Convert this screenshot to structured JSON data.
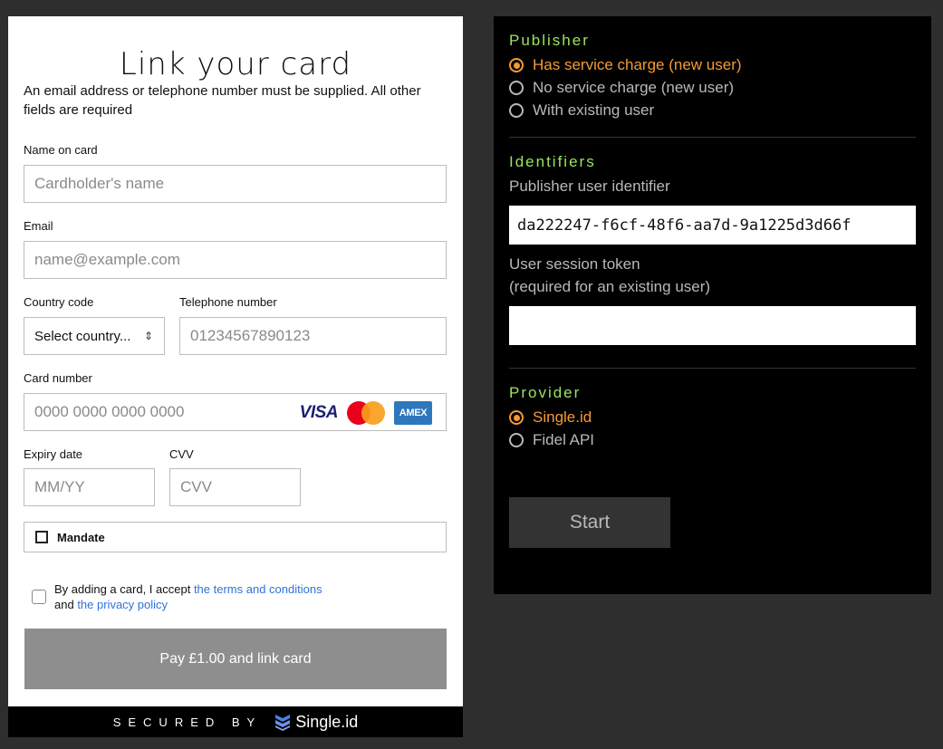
{
  "form": {
    "title": "Link your card",
    "subtitle": "An email address or telephone number must be supplied. All other fields are required",
    "name_label": "Name on card",
    "name_placeholder": "Cardholder's name",
    "email_label": "Email",
    "email_placeholder": "name@example.com",
    "country_label": "Country code",
    "country_value": "Select country...",
    "phone_label": "Telephone number",
    "phone_placeholder": "01234567890123",
    "card_label": "Card number",
    "card_placeholder": "0000 0000 0000 0000",
    "card_brands": {
      "visa": "VISA",
      "amex": "AMEX"
    },
    "expiry_label": "Expiry date",
    "expiry_placeholder": "MM/YY",
    "cvv_label": "CVV",
    "cvv_placeholder": "CVV",
    "mandate_label": "Mandate",
    "terms": {
      "prefix": "By adding a card, I accept ",
      "terms_link": "the terms and conditions",
      "middle": "and ",
      "privacy_link": "the privacy policy"
    },
    "pay_button": "Pay £1.00 and link card",
    "footer": {
      "secured": "SECURED BY",
      "brand": "Single.id"
    }
  },
  "config": {
    "publisher_title": "Publisher",
    "publisher_options": [
      {
        "label": "Has service charge (new user)",
        "selected": true
      },
      {
        "label": "No service charge (new user)",
        "selected": false
      },
      {
        "label": "With existing user",
        "selected": false
      }
    ],
    "identifiers_title": "Identifiers",
    "publisher_user_id_label": "Publisher user identifier",
    "publisher_user_id_value": "da222247-f6cf-48f6-aa7d-9a1225d3d66f",
    "session_token_label": "User session token",
    "session_token_hint": "(required for an existing user)",
    "session_token_value": "",
    "provider_title": "Provider",
    "provider_options": [
      {
        "label": "Single.id",
        "selected": true
      },
      {
        "label": "Fidel API",
        "selected": false
      }
    ],
    "start_button": "Start"
  },
  "colors": {
    "accent_green": "#9ae65e",
    "accent_orange": "#f59a37",
    "link_blue": "#2f73d9",
    "pay_button_gray": "#8e8e8e"
  },
  "icons": [
    "chevron-updown-icon",
    "visa-logo",
    "mastercard-logo",
    "amex-logo",
    "single-id-logo-icon"
  ]
}
